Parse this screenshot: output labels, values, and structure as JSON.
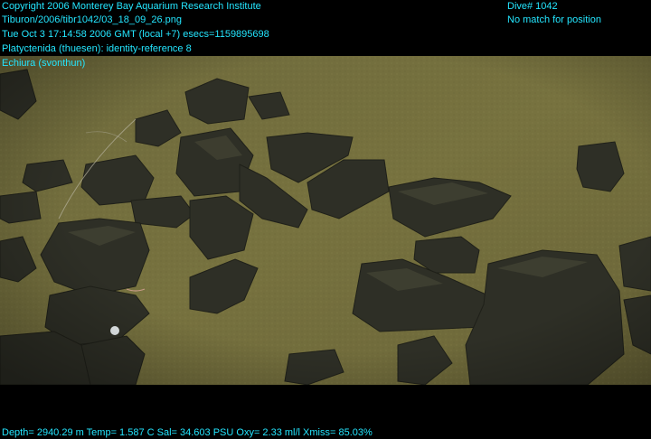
{
  "header": {
    "copyright": "Copyright 2006 Monterey Bay Aquarium Research Institute",
    "image_path": "Tiburon/2006/tibr1042/03_18_09_26.png",
    "timestamp": "Tue Oct  3 17:14:58 2006 GMT (local +7)  esecs=1159895698",
    "annotation_1": "Platyctenida (thuesen): identity-reference 8",
    "annotation_2": "Echiura (svonthun)",
    "dive": "Dive# 1042",
    "position_status": "No match for position"
  },
  "footer": {
    "telemetry": "Depth= 2940.29 m  Temp= 1.587 C  Sal= 34.603 PSU  Oxy= 2.33 ml/l  Xmiss= 85.03%"
  },
  "colors": {
    "overlay_text": "#24e6ff",
    "sediment": "#6f6a3a",
    "rock": "#2c2d24"
  }
}
